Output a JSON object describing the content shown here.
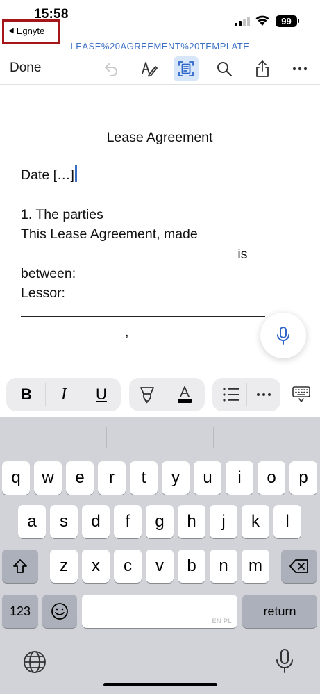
{
  "status_bar": {
    "time": "15:58",
    "battery": "99"
  },
  "nav": {
    "back_label": "Egnyte",
    "document_filename": "LEASE%20AGREEMENT%20TEMPLATE"
  },
  "toolbar": {
    "done_label": "Done",
    "icons": [
      "undo-icon",
      "pen-icon",
      "reading-mode-icon",
      "search-icon",
      "share-icon",
      "more-icon"
    ],
    "accent": "#3b6fc4"
  },
  "document": {
    "title": "Lease Agreement",
    "date_line": "Date […]",
    "section_heading": "1. The parties",
    "line_made": "This Lease Agreement, made",
    "line_is": " is",
    "line_between": "between:",
    "line_lessor": "Lessor:",
    "comma": ","
  },
  "format_bar": {
    "bold": "B",
    "italic": "I",
    "underline": "U"
  },
  "keyboard": {
    "row1": [
      "q",
      "w",
      "e",
      "r",
      "t",
      "y",
      "u",
      "i",
      "o",
      "p"
    ],
    "row2": [
      "a",
      "s",
      "d",
      "f",
      "g",
      "h",
      "j",
      "k",
      "l"
    ],
    "row3": [
      "z",
      "x",
      "c",
      "v",
      "b",
      "n",
      "m"
    ],
    "numbers_key": "123",
    "return_key": "return",
    "space_languages": "EN PL"
  }
}
